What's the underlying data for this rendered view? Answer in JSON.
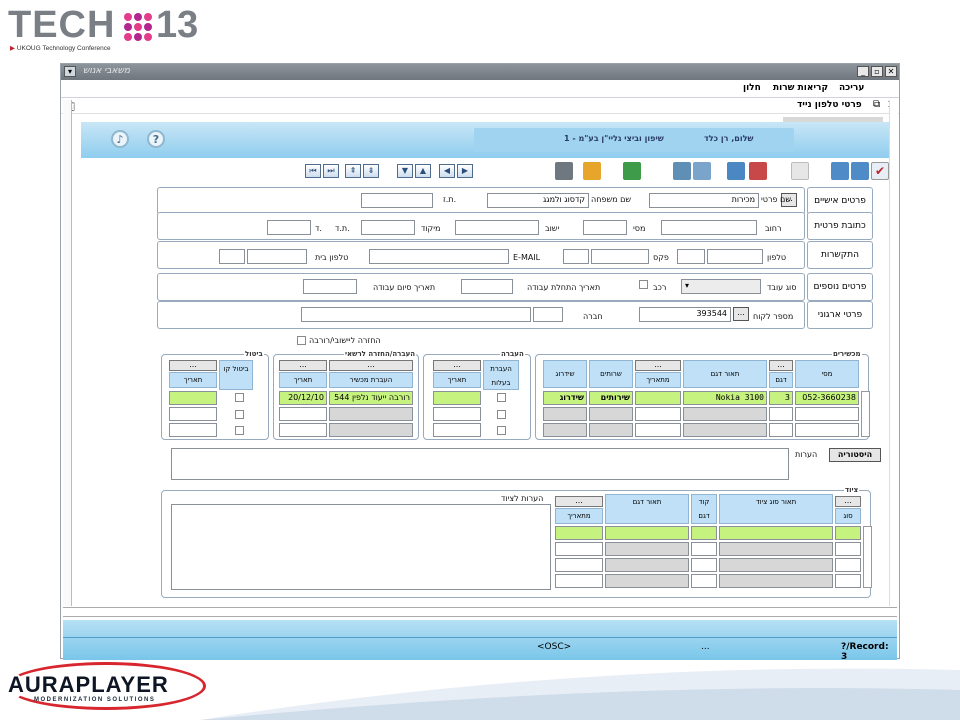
{
  "slide": {
    "tech_logo_text": "TECH",
    "tech_logo_number": "13",
    "tech_logo_sub": "UKOUG Technology Conference",
    "aura_logo": "AURAPLAYER",
    "aura_sub": "MODERNIZATION SOLUTIONS"
  },
  "window": {
    "title": "משאבי אנוש",
    "controls": [
      "_",
      "ð",
      "X"
    ],
    "menu": [
      "עריכה",
      "קריאות שרות",
      "חלון"
    ],
    "form_title": "פרטי טלפון נייד"
  },
  "header": {
    "name_line": "שלום, רן כלד",
    "name_detail": "1 - שיפון וביצי גליי\"ן בע\"מ"
  },
  "rows": {
    "personal": {
      "section": "פרטים אישיים",
      "first_name_label": "שם פרטי",
      "first_name": "מכירות",
      "last_name_label": "שם משפחה",
      "last_name": "קדסוג ולמגג",
      "id_label": "ת.ז."
    },
    "address": {
      "section": "כתובת פרטית",
      "street_label": "רחוב",
      "number_label": "מסי",
      "city_label": "ישוב",
      "zip_label": "מיקוד",
      "pobox_label": "ת.ד.",
      "extra_label": "ד."
    },
    "contact": {
      "section": "התקשרות",
      "phone_label": "טלפון",
      "fax_label": "פקס",
      "email_label": "E-MAIL",
      "home_phone_label": "טלפון בית"
    },
    "extra": {
      "section": "פרטים נוספים",
      "employee_type_label": "סוג עובד",
      "car_label": "רכב",
      "start_date_label": "תאריך התחלת עבודה",
      "end_date_label": "תאריך סיום עבודה"
    },
    "org": {
      "section": "פרטי ארגוני",
      "customer_no_label": "מספר לקוח",
      "customer_no": "393544",
      "company_label": "חברה"
    }
  },
  "return_checkbox_label": "החזרה ליישובי/רורבה",
  "devices": {
    "title": "מכשירים",
    "headers": [
      "מסי",
      "דגם",
      "תאור דגם",
      "מתאריך",
      "שרותים",
      "שידרוג"
    ],
    "row1": [
      "052-3660238",
      "3",
      "Nokia 3100",
      "",
      "שירותים",
      "שידרוג"
    ]
  },
  "transfer": {
    "title": "העברה",
    "headers": [
      "העברת בעלות",
      "תאריך"
    ]
  },
  "transfer_return": {
    "title": "העברה/החזרה לרשאי",
    "headers": [
      "העברת מכשיר",
      "תאריך"
    ],
    "row1": [
      "רורבה ייעוד נלפין 544",
      "20/12/10"
    ]
  },
  "cancel": {
    "title": "ביטול",
    "headers": [
      "ביטול קו",
      "תאריך"
    ]
  },
  "notes": {
    "label": "הערות",
    "history_button": "היסטוריה"
  },
  "equipment": {
    "title": "ציוד",
    "headers": [
      "סוג",
      "תאור סוג ציוד",
      "קוד דגם",
      "תאור דגם",
      "מתאריך"
    ],
    "notes_label": "הערות לציוד"
  },
  "status": {
    "osc": "<OSC>",
    "dots": "...",
    "record": "?/Record: 3"
  },
  "colors": {
    "highlight_row": "#c6f27f",
    "header_cells": "#bfe0f7",
    "status_bar": "#79c6ea",
    "brand_red": "#d7262e"
  }
}
